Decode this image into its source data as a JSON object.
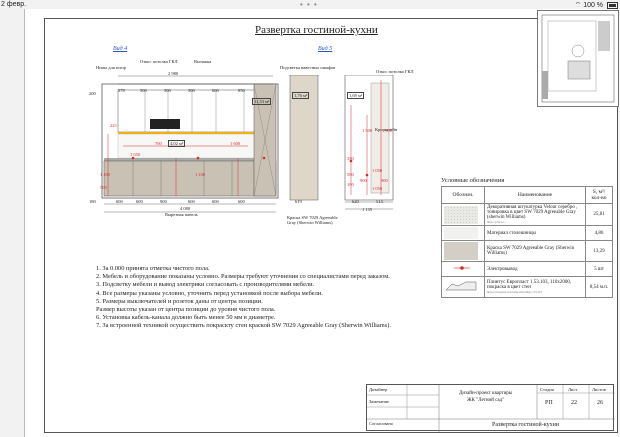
{
  "status": {
    "date": "2 февр.",
    "battery": "100 %"
  },
  "title": "Развертка гостиной-кухни",
  "views": {
    "view4": "Вид 4",
    "view5": "Вид 5"
  },
  "dims": {
    "top_total": "2 980",
    "bottom_total": "4 080",
    "upper_widths": [
      "578",
      "500",
      "500",
      "500",
      "600",
      "850"
    ],
    "lower_widths": [
      "600",
      "600",
      "900",
      "600",
      "600",
      "600"
    ],
    "height_200": "200",
    "height_180": "180",
    "height_225": "225",
    "height_700": "700",
    "height_1600": "1 600",
    "height_1050": "1 050",
    "left_1400": "1 400",
    "left_1100": "1 100",
    "left_500": "500",
    "area1": "11,53 м²",
    "area2": "4,02 м²",
    "area3": "1,76 м²",
    "area4": "1,69 м²",
    "side_width1": "619",
    "side_width2": "620",
    "side_width3": "514",
    "side_total": "1 135",
    "side_heights": [
      "350",
      "1 050",
      "900",
      "900",
      "500",
      "100",
      "1 000",
      "1 500",
      "1 050"
    ]
  },
  "callouts": {
    "niche": "Ниша для штор",
    "lamp1": "Откос потолка ГКЛ",
    "hood": "Вытяжка",
    "backlit": "Подсветка навесных шкафов",
    "lamp2": "Откос потолка ГКЛ",
    "kr": "Кронштейн",
    "paint": "Краска SW 7029 Agreeable Gray (Sherwin Williams)",
    "panel": "Вырезная панель"
  },
  "legend": {
    "title": "Условные обозначения",
    "headers": {
      "sym": "Обознач.",
      "name": "Наименование",
      "area": "S, м²/ кол-во"
    },
    "rows": [
      {
        "name": "Декоративная штукатурка Velour серебро , тонировка в цвет SW 7029 Agreeable Gray (sherwin Williams)",
        "sub": "https://prnt.sc/...",
        "value": "25,81",
        "swatch": "#e9e9e6"
      },
      {
        "name": "Материал столешницы",
        "sub": "",
        "value": "4,86",
        "swatch": "#f1f1ef"
      },
      {
        "name": "Краска SW 7029 Agreeable Gray (Sherwin Williams)",
        "sub": "",
        "value": "13,29",
        "swatch": "#d3cfc6"
      },
      {
        "name": "Электровывод",
        "sub": "",
        "value": "5 шт",
        "swatch": "#ffffff"
      },
      {
        "name": "Плинтус Европласт 1.53.103, 110х2000, покраска в цвет стен",
        "sub": "https://evroplast.ru/product/molding/1.53.103",
        "value": "8,54 м.п.",
        "swatch": "#ffffff"
      }
    ]
  },
  "notes": [
    "1. За 0.000 принята отметка чистого пола.",
    "2. Мебель и оборудование показаны условно. Размеры требуют уточнения со специалистами перед заказом.",
    "3. Подсветку мебели и вывод электрики согласовать с производителями мебели.",
    "4. Все размеры указаны условно, уточнить перед установкой после выбора мебели.",
    "5. Размеры выключателей и розеток даны от центра позиции.",
    "Размер высоты указан от центра позиции до уровня чистого пола.",
    "6. Установка кабель-канала должно быть менее 50 мм в диаметре.",
    "7. За встроенной техникой осуществить покраскту стен  краской SW 7029 Agreeable Gray (Sherwin Williams)."
  ],
  "stamp": {
    "designer": "Дизайнер",
    "checked": "Замечание",
    "approved": "Согласовано",
    "project": "Дизайн-проект квартиры",
    "complex": "ЖК \"Летний сад\"",
    "stage_h": "Стадия",
    "sheet_h": "Лист",
    "sheets_h": "Листов",
    "stage": "РП",
    "sheet": "22",
    "sheets": "26",
    "drawing": "Развертка гостиной-кухни"
  }
}
